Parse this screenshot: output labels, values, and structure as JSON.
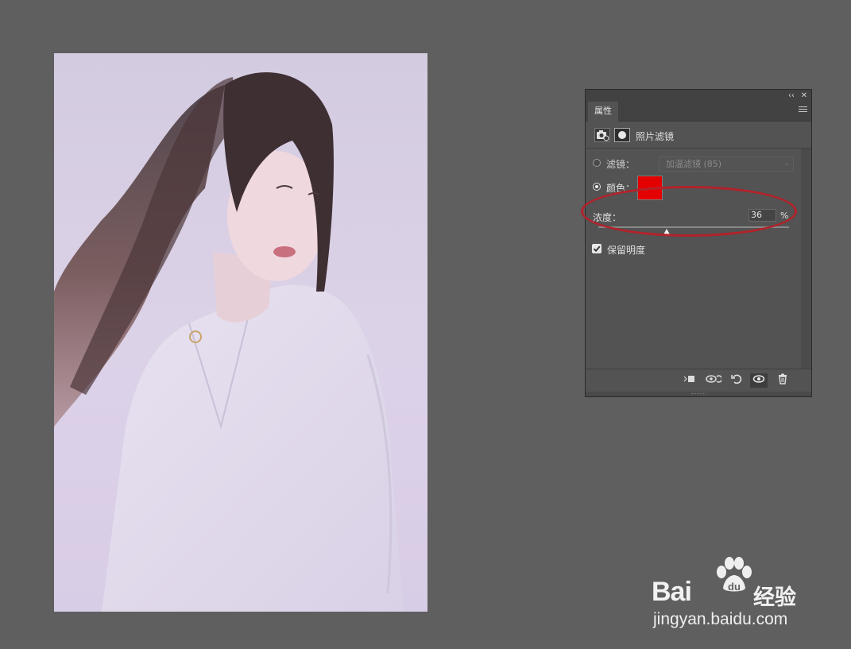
{
  "panel": {
    "tab_label": "属性",
    "collapse_glyph": "‹‹",
    "close_glyph": "✕",
    "header_title": "照片滤镜",
    "filter_label": "滤镜：",
    "filter_value": "加温滤镜 (85)",
    "color_label": "颜色：",
    "color_value": "#e50000",
    "density_label": "浓度：",
    "density_value": "36",
    "density_unit": "%",
    "density_level": 0.36,
    "preserve_label": "保留明度",
    "preserve_checked": true,
    "filter_selected": false,
    "color_selected": true,
    "footer_icons": [
      "clip-to-layer-icon",
      "view-previous-state-icon",
      "reset-icon",
      "visibility-icon",
      "delete-icon"
    ]
  },
  "annotation": {
    "color": "#b2222a"
  },
  "watermark": {
    "brand": "Bai",
    "brand_suffix": "du",
    "cn": "经验",
    "url": "jingyan.baidu.com"
  }
}
